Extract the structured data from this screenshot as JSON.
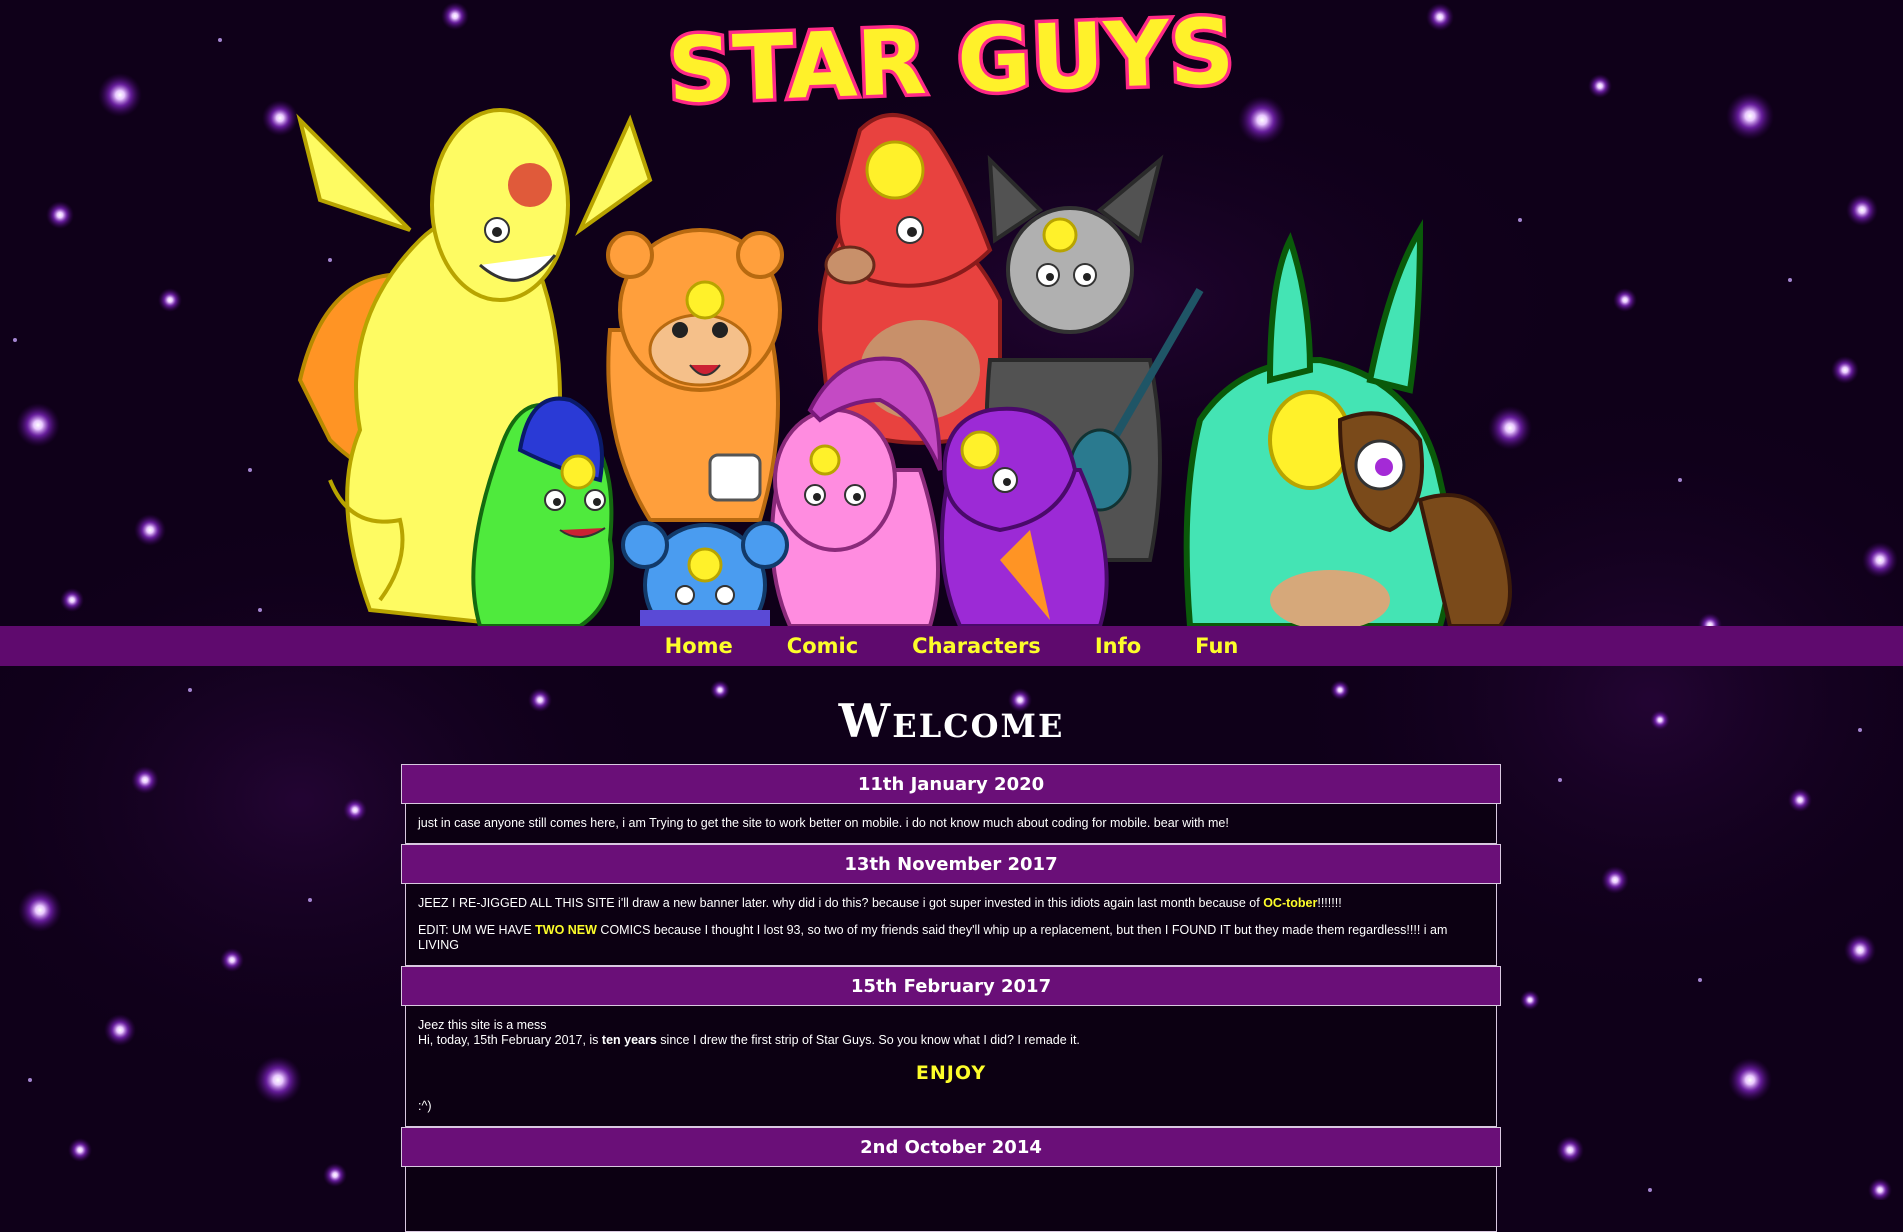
{
  "site": {
    "title": "STAR GUYS",
    "colors": {
      "background": "#0f0019",
      "nav": "#5f0a6e",
      "link": "#fdfd2a",
      "header": "#6a0f78"
    }
  },
  "nav": {
    "items": [
      {
        "label": "Home"
      },
      {
        "label": "Comic"
      },
      {
        "label": "Characters"
      },
      {
        "label": "Info"
      },
      {
        "label": "Fun"
      }
    ]
  },
  "page": {
    "heading": "Welcome"
  },
  "news": [
    {
      "date": "11th January 2020",
      "text": "just in case anyone still comes here, i am Trying to get the site to work better on mobile. i do not know much about coding for mobile. bear with me!"
    },
    {
      "date": "13th November 2017",
      "p1_a": "JEEZ I RE-JIGGED ALL THIS SITE i'll draw a new banner later. why did i do this? because i got super invested in this idiots again last month because of ",
      "p1_link": "OC-tober",
      "p1_b": "!!!!!!!",
      "p2_a": "EDIT: UM WE HAVE ",
      "p2_link": "TWO NEW",
      "p2_b": " COMICS because I thought I lost 93, so two of my friends said they'll whip up a replacement, but then I FOUND IT but they made them regardless!!!! i am LIVING"
    },
    {
      "date": "15th February 2017",
      "line1": "Jeez this site is a mess",
      "line2_a": "Hi, today, 15th February 2017, is ",
      "line2_bold": "ten years",
      "line2_b": " since I drew the first strip of Star Guys. So you know what I did? I remade it.",
      "enjoy": "ENJOY",
      "smiley": ":^)"
    },
    {
      "date": "2nd October 2014"
    }
  ]
}
